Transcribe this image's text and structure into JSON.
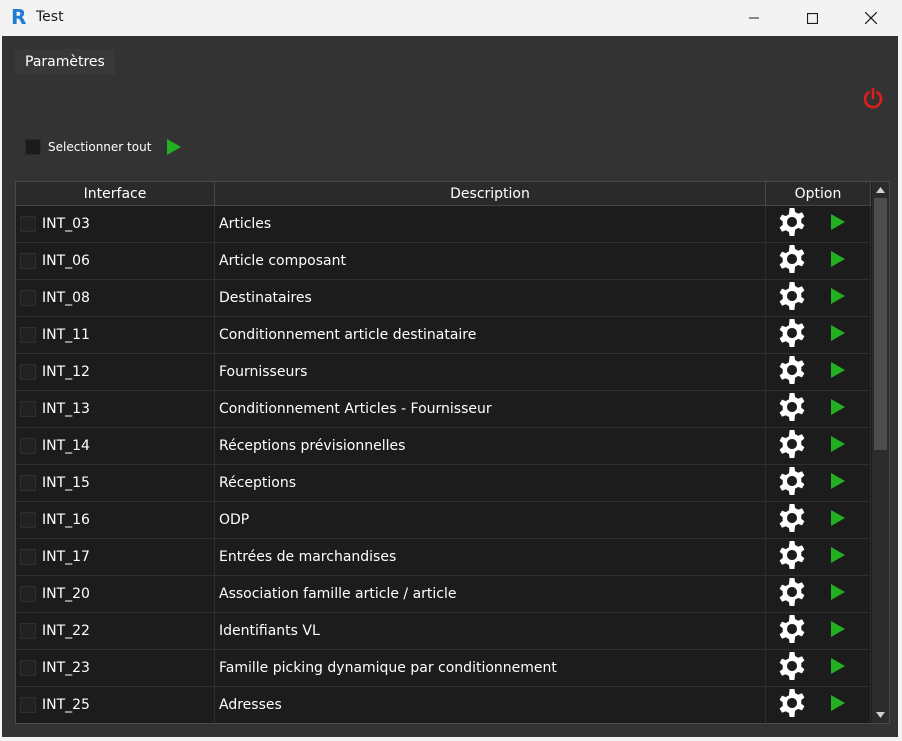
{
  "window": {
    "logo_letter": "R",
    "title": "Test",
    "minimize_icon": "minimize-icon",
    "maximize_icon": "maximize-icon",
    "close_icon": "close-icon"
  },
  "menubar": {
    "parametres": "Paramètres"
  },
  "power_icon": {
    "name": "power-icon",
    "color": "#e21c1c"
  },
  "select_all": {
    "label": "Selectionner tout",
    "checked": false
  },
  "accent_colors": {
    "play": "#22b022",
    "power": "#e21c1c"
  },
  "grid": {
    "headers": {
      "interface": "Interface",
      "description": "Description",
      "option": "Option"
    },
    "rows": [
      {
        "interface": "INT_03",
        "description": "Articles"
      },
      {
        "interface": "INT_06",
        "description": "Article composant"
      },
      {
        "interface": "INT_08",
        "description": "Destinataires"
      },
      {
        "interface": "INT_11",
        "description": "Conditionnement article destinataire"
      },
      {
        "interface": "INT_12",
        "description": "Fournisseurs"
      },
      {
        "interface": "INT_13",
        "description": "Conditionnement Articles - Fournisseur"
      },
      {
        "interface": "INT_14",
        "description": "Réceptions prévisionnelles"
      },
      {
        "interface": "INT_15",
        "description": "Réceptions"
      },
      {
        "interface": "INT_16",
        "description": "ODP"
      },
      {
        "interface": "INT_17",
        "description": "Entrées de marchandises"
      },
      {
        "interface": "INT_20",
        "description": "Association famille article / article"
      },
      {
        "interface": "INT_22",
        "description": "Identifiants VL"
      },
      {
        "interface": "INT_23",
        "description": "Famille picking dynamique par conditionnement"
      },
      {
        "interface": "INT_25",
        "description": "Adresses"
      }
    ]
  }
}
